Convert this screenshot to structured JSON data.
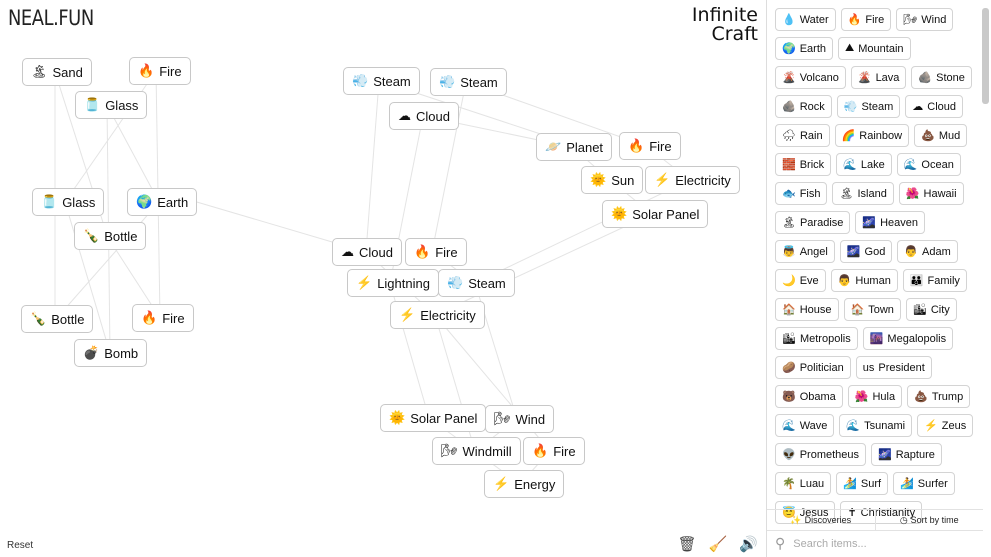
{
  "header": {
    "logo": "NEAL.FUN",
    "title_line1": "Infinite",
    "title_line2": "Craft"
  },
  "canvas_items": [
    {
      "emoji": "🏝",
      "label": "Sand"
    },
    {
      "emoji": "🔥",
      "label": "Fire"
    },
    {
      "emoji": "🫙",
      "label": "Glass"
    },
    {
      "emoji": "🫙",
      "label": "Glass"
    },
    {
      "emoji": "🌍",
      "label": "Earth"
    },
    {
      "emoji": "🍾",
      "label": "Bottle"
    },
    {
      "emoji": "🍾",
      "label": "Bottle"
    },
    {
      "emoji": "🔥",
      "label": "Fire"
    },
    {
      "emoji": "💣",
      "label": "Bomb"
    },
    {
      "emoji": "💨",
      "label": "Steam"
    },
    {
      "emoji": "💨",
      "label": "Steam"
    },
    {
      "emoji": "☁",
      "label": "Cloud"
    },
    {
      "emoji": "🪐",
      "label": "Planet"
    },
    {
      "emoji": "🔥",
      "label": "Fire"
    },
    {
      "emoji": "🌞",
      "label": "Sun"
    },
    {
      "emoji": "⚡",
      "label": "Electricity"
    },
    {
      "emoji": "🌞",
      "label": "Solar Panel"
    },
    {
      "emoji": "☁",
      "label": "Cloud"
    },
    {
      "emoji": "🔥",
      "label": "Fire"
    },
    {
      "emoji": "⚡",
      "label": "Lightning"
    },
    {
      "emoji": "💨",
      "label": "Steam"
    },
    {
      "emoji": "⚡",
      "label": "Electricity"
    },
    {
      "emoji": "🌞",
      "label": "Solar Panel"
    },
    {
      "emoji": "🌬",
      "label": "Wind"
    },
    {
      "emoji": "🌬",
      "label": "Windmill"
    },
    {
      "emoji": "🔥",
      "label": "Fire"
    },
    {
      "emoji": "⚡",
      "label": "Energy"
    }
  ],
  "footer": {
    "reset": "Reset"
  },
  "sidebar": {
    "items": [
      {
        "emoji": "💧",
        "label": "Water"
      },
      {
        "emoji": "🔥",
        "label": "Fire"
      },
      {
        "emoji": "🌬",
        "label": "Wind"
      },
      {
        "emoji": "🌍",
        "label": "Earth"
      },
      {
        "emoji": "⛰",
        "label": "Mountain"
      },
      {
        "emoji": "🌋",
        "label": "Volcano"
      },
      {
        "emoji": "🌋",
        "label": "Lava"
      },
      {
        "emoji": "🪨",
        "label": "Stone"
      },
      {
        "emoji": "🪨",
        "label": "Rock"
      },
      {
        "emoji": "💨",
        "label": "Steam"
      },
      {
        "emoji": "☁",
        "label": "Cloud"
      },
      {
        "emoji": "🌧",
        "label": "Rain"
      },
      {
        "emoji": "🌈",
        "label": "Rainbow"
      },
      {
        "emoji": "💩",
        "label": "Mud"
      },
      {
        "emoji": "🧱",
        "label": "Brick"
      },
      {
        "emoji": "🌊",
        "label": "Lake"
      },
      {
        "emoji": "🌊",
        "label": "Ocean"
      },
      {
        "emoji": "🐟",
        "label": "Fish"
      },
      {
        "emoji": "🏝",
        "label": "Island"
      },
      {
        "emoji": "🌺",
        "label": "Hawaii"
      },
      {
        "emoji": "🏝",
        "label": "Paradise"
      },
      {
        "emoji": "🌌",
        "label": "Heaven"
      },
      {
        "emoji": "👼",
        "label": "Angel"
      },
      {
        "emoji": "🌌",
        "label": "God"
      },
      {
        "emoji": "👨",
        "label": "Adam"
      },
      {
        "emoji": "🌙",
        "label": "Eve"
      },
      {
        "emoji": "👨",
        "label": "Human"
      },
      {
        "emoji": "👪",
        "label": "Family"
      },
      {
        "emoji": "🏠",
        "label": "House"
      },
      {
        "emoji": "🏠",
        "label": "Town"
      },
      {
        "emoji": "🏙",
        "label": "City"
      },
      {
        "emoji": "🏙",
        "label": "Metropolis"
      },
      {
        "emoji": "🌆",
        "label": "Megalopolis"
      },
      {
        "emoji": "🥔",
        "label": "Politician"
      },
      {
        "emoji": "us",
        "label": "President"
      },
      {
        "emoji": "🐻",
        "label": "Obama"
      },
      {
        "emoji": "🌺",
        "label": "Hula"
      },
      {
        "emoji": "💩",
        "label": "Trump"
      },
      {
        "emoji": "🌊",
        "label": "Wave"
      },
      {
        "emoji": "🌊",
        "label": "Tsunami"
      },
      {
        "emoji": "⚡",
        "label": "Zeus"
      },
      {
        "emoji": "👽",
        "label": "Prometheus"
      },
      {
        "emoji": "🌌",
        "label": "Rapture"
      },
      {
        "emoji": "🌴",
        "label": "Luau"
      },
      {
        "emoji": "🏄",
        "label": "Surf"
      },
      {
        "emoji": "🏄",
        "label": "Surfer"
      },
      {
        "emoji": "😇",
        "label": "Jesus"
      },
      {
        "emoji": "✝",
        "label": "Christianity"
      }
    ],
    "discoveries": "Discoveries",
    "sort": "Sort by time",
    "search_placeholder": "Search items..."
  }
}
